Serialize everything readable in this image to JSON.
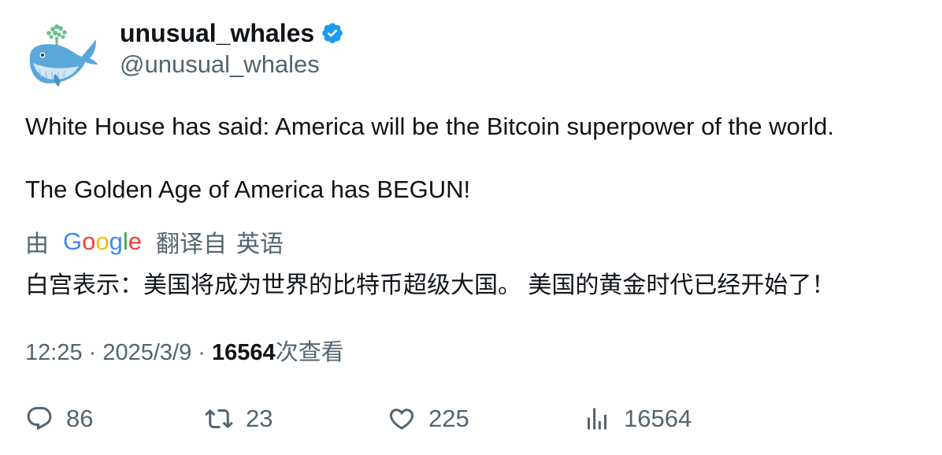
{
  "author": {
    "display_name": "unusual_whales",
    "handle": "@unusual_whales",
    "avatar_icon": "whale-avatar-icon",
    "verified_icon": "verified-badge-icon",
    "verified_color": "#1d9bf0"
  },
  "tweet": {
    "line1": "White House has said: America will be the Bitcoin superpower of the world.",
    "line2": "The Golden Age of America has BEGUN!"
  },
  "translation": {
    "by_label": "由",
    "provider": "Google",
    "link_label": "翻译自",
    "source_language": "英语",
    "translated_text": "白宫表示：美国将成为世界的比特币超级大国。 美国的黄金时代已经开始了！"
  },
  "meta": {
    "time": "12:25",
    "separator": " · ",
    "date": "2025/3/9",
    "views_count": "16564",
    "views_label": "次查看"
  },
  "actions": {
    "replies": "86",
    "retweets": "23",
    "likes": "225",
    "views": "16564"
  },
  "colors": {
    "text_primary": "#0f1419",
    "text_secondary": "#536471",
    "accent": "#1d9bf0"
  }
}
